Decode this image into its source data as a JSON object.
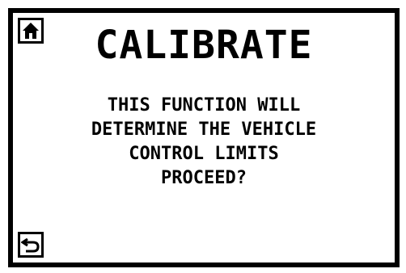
{
  "screen": {
    "title": "CALIBRATE",
    "message_lines": [
      "THIS FUNCTION WILL",
      "DETERMINE THE VEHICLE",
      "CONTROL LIMITS",
      "PROCEED?"
    ]
  },
  "icons": {
    "home": "home-icon",
    "back": "back-arrow-icon"
  },
  "colors": {
    "foreground": "#000000",
    "background": "#ffffff"
  }
}
